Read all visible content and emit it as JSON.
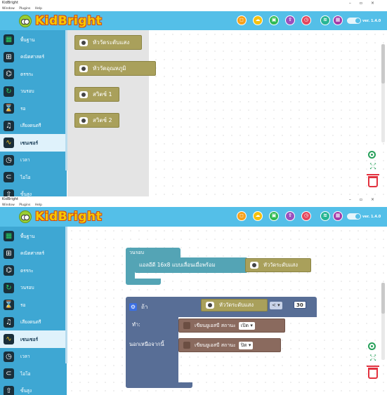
{
  "app": {
    "title": "KidBright",
    "menu": [
      "Window",
      "Plugins",
      "Help"
    ],
    "logo": "KidBright",
    "version": "ver. 1.4.0"
  },
  "header_buttons": [
    {
      "name": "new-file-button",
      "icon": "file-icon",
      "color": "#f6a11a",
      "glyph": "◻"
    },
    {
      "name": "open-button",
      "icon": "cloud-icon",
      "color": "#f6c10e",
      "glyph": "☁"
    },
    {
      "name": "save-button",
      "icon": "save-icon",
      "color": "#2fba52",
      "glyph": "▣"
    },
    {
      "name": "upload-button",
      "icon": "upload-icon",
      "color": "#9a4fbd",
      "glyph": "⇧"
    },
    {
      "name": "alarm-button",
      "icon": "alarm-icon",
      "color": "#e4475e",
      "glyph": "◷"
    },
    {
      "name": "wifi-button",
      "icon": "wifi-icon",
      "color": "#27b593",
      "glyph": "≋"
    },
    {
      "name": "board-button",
      "icon": "board-icon",
      "color": "#a23ba8",
      "glyph": "▦"
    }
  ],
  "categories": [
    {
      "label": "พื้นฐาน",
      "icon": "grid-icon",
      "glyph": "▦"
    },
    {
      "label": "คณิตศาสตร์",
      "icon": "calculator-icon",
      "glyph": "⊞"
    },
    {
      "label": "ตรรกะ",
      "icon": "logic-icon",
      "glyph": "⌬"
    },
    {
      "label": "วนรอบ",
      "icon": "loop-icon",
      "glyph": "↻"
    },
    {
      "label": "รอ",
      "icon": "wait-icon",
      "glyph": "⌛"
    },
    {
      "label": "เสียงดนตรี",
      "icon": "music-icon",
      "glyph": "♫"
    },
    {
      "label": "เซนเซอร์",
      "icon": "sensor-icon",
      "glyph": "∿"
    },
    {
      "label": "เวลา",
      "icon": "clock-icon",
      "glyph": "◷"
    },
    {
      "label": "ไอโอ",
      "icon": "io-icon",
      "glyph": "⊂"
    },
    {
      "label": "ขั้นสูง",
      "icon": "advanced-icon",
      "glyph": "⇧"
    }
  ],
  "flyout_blocks": [
    "หัววัดระดับแสง",
    "หัววัดอุณหภูมิ",
    "สวิตช์ 1",
    "สวิตช์ 2"
  ],
  "program": {
    "loop_label": "วนรอบ",
    "scroll_text": "แอลอีดี 16x8 แบบเลื่อนเมื่อพร้อม",
    "light_sensor": "หัววัดระดับแสง",
    "if_label": "ถ้า",
    "do_label": "ทำ:",
    "else_label": "นอกเหนือจากนี้",
    "compare_op": "<",
    "compare_value": "30",
    "write_led": "เขียนยูเอสบี สถานะ",
    "state_on": "เปิด",
    "state_off": "ปิด"
  }
}
